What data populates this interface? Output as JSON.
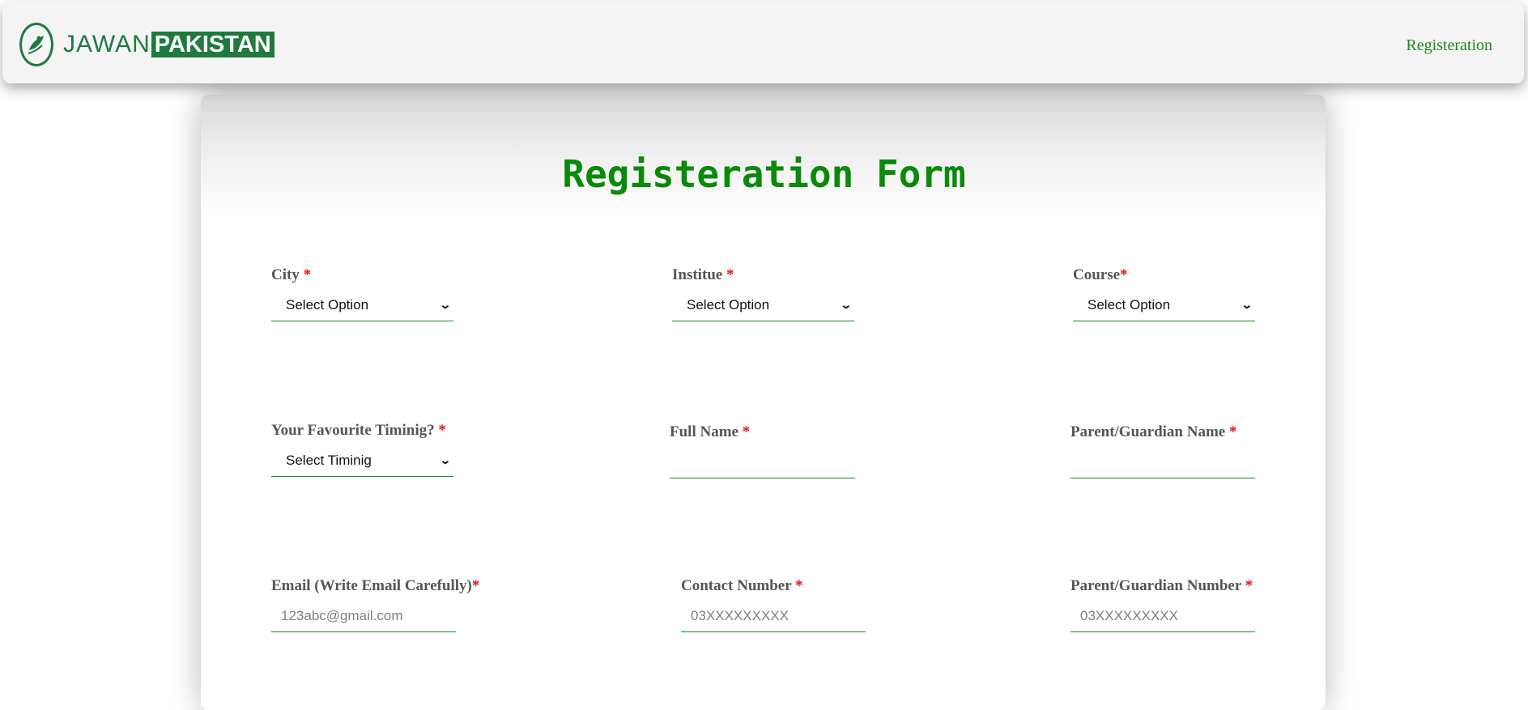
{
  "brand": {
    "part1": "JAWAN",
    "part2": "PAKISTAN"
  },
  "nav": {
    "registration_link": "Registeration"
  },
  "form": {
    "title": "Registeration Form",
    "city": {
      "label": "City ",
      "required_mark": "*",
      "value": "Select Option"
    },
    "institute": {
      "label": "Institue ",
      "required_mark": "*",
      "value": "Select Option"
    },
    "course": {
      "label": "Course",
      "required_mark": "*",
      "value": "Select Option"
    },
    "timing": {
      "label": "Your Favourite Timinig? ",
      "required_mark": "*",
      "value": "Select Timinig"
    },
    "full_name": {
      "label": "Full Name ",
      "required_mark": "*",
      "value": "",
      "placeholder": ""
    },
    "guardian_name": {
      "label": "Parent/Guardian Name ",
      "required_mark": "*",
      "value": "",
      "placeholder": ""
    },
    "email": {
      "label": "Email (Write Email Carefully)",
      "required_mark": "*",
      "placeholder": "123abc@gmail.com"
    },
    "contact": {
      "label": "Contact Number ",
      "required_mark": "*",
      "placeholder": "03XXXXXXXXX"
    },
    "guardian_number": {
      "label": "Parent/Guardian Number ",
      "required_mark": "*",
      "placeholder": "03XXXXXXXXX"
    }
  },
  "colors": {
    "brand_green": "#1f7a3d",
    "title_green": "#0a8a0a",
    "required_red": "#e0101a"
  },
  "icons": {
    "logo": "leaf-bird-logo-icon",
    "dropdown": "chevron-down-icon"
  }
}
